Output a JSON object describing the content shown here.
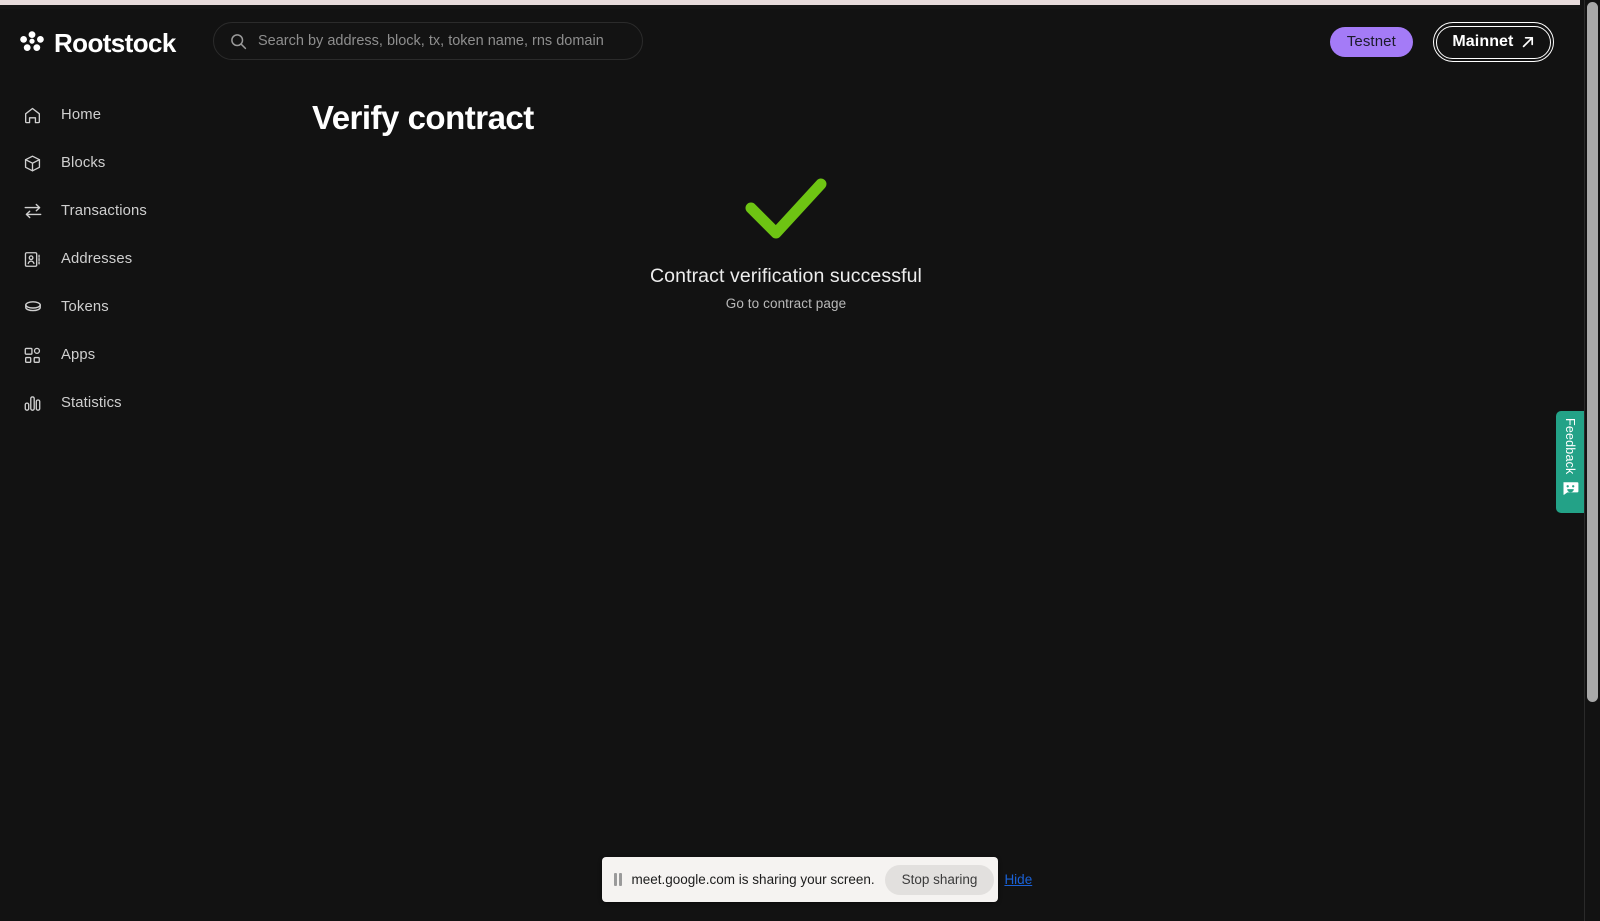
{
  "brand": {
    "name": "Rootstock",
    "logo_icon": "rootstock-clover-icon"
  },
  "search": {
    "placeholder": "Search by address, block, tx, token name, rns domain",
    "value": "",
    "icon": "search-icon"
  },
  "network": {
    "testnet_label": "Testnet",
    "mainnet_label": "Mainnet",
    "mainnet_icon": "arrow-up-right-icon",
    "testnet_color": "#a47bf7",
    "active": "Testnet"
  },
  "sidebar": {
    "items": [
      {
        "label": "Home",
        "icon": "home-icon"
      },
      {
        "label": "Blocks",
        "icon": "cube-icon"
      },
      {
        "label": "Transactions",
        "icon": "transfer-arrows-icon"
      },
      {
        "label": "Addresses",
        "icon": "contact-card-icon"
      },
      {
        "label": "Tokens",
        "icon": "coin-icon"
      },
      {
        "label": "Apps",
        "icon": "apps-grid-icon"
      },
      {
        "label": "Statistics",
        "icon": "bar-chart-icon"
      }
    ]
  },
  "main": {
    "page_title": "Verify contract",
    "result": {
      "status_icon": "green-checkmark-icon",
      "status_color": "#6ec413",
      "title": "Contract verification successful",
      "link_label": "Go to contract page"
    }
  },
  "feedback": {
    "label": "Feedback",
    "icon": "smiley-face-icon",
    "color": "#23a287"
  },
  "share_bar": {
    "pause_icon": "pause-icon",
    "message": "meet.google.com is sharing your screen.",
    "stop_label": "Stop sharing",
    "hide_label": "Hide"
  }
}
